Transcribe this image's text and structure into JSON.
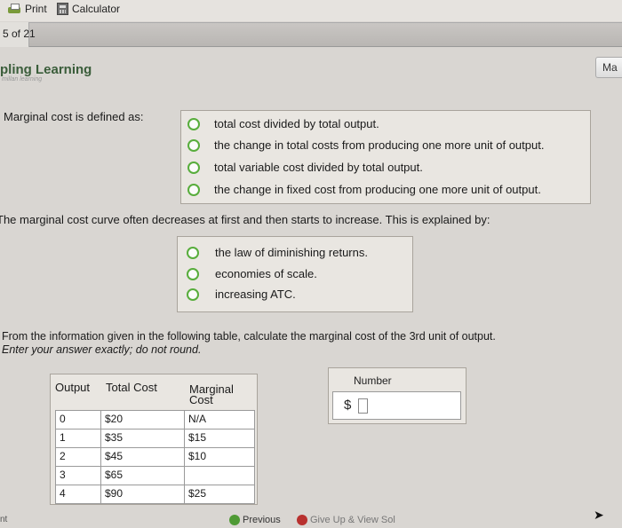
{
  "toolbar": {
    "print_label": "Print",
    "calculator_label": "Calculator"
  },
  "progress": {
    "text": "5 of 21",
    "current": 5,
    "total": 21
  },
  "brand": {
    "title": "pling Learning",
    "subtitle": "millan learning",
    "map_button": "Ma"
  },
  "q1": {
    "prompt": "Marginal cost is defined as:",
    "options": [
      "total cost divided by total output.",
      "the change in total costs from producing one more unit of output.",
      "total variable cost divided by total output.",
      "the change in fixed cost from producing one more unit of output."
    ]
  },
  "q2": {
    "prompt": "The marginal cost curve often decreases at first and then starts to increase. This is explained by:",
    "options": [
      "the law of diminishing returns.",
      "economies of scale.",
      "increasing ATC."
    ]
  },
  "q3": {
    "prompt": "From the information given in the following table, calculate the marginal cost of the 3rd unit of output.",
    "instruction": "Enter your answer exactly; do not round.",
    "table": {
      "headers": [
        "Output",
        "Total Cost",
        "Marginal Cost"
      ],
      "rows": [
        [
          "0",
          "$20",
          "N/A"
        ],
        [
          "1",
          "$35",
          "$15"
        ],
        [
          "2",
          "$45",
          "$10"
        ],
        [
          "3",
          "$65",
          ""
        ],
        [
          "4",
          "$90",
          "$25"
        ]
      ]
    },
    "answer": {
      "label": "Number",
      "prefix": "$",
      "value": ""
    }
  },
  "footer": {
    "previous_label": "Previous",
    "give_up_label": "Give Up & View Sol",
    "left_text": "nt"
  }
}
